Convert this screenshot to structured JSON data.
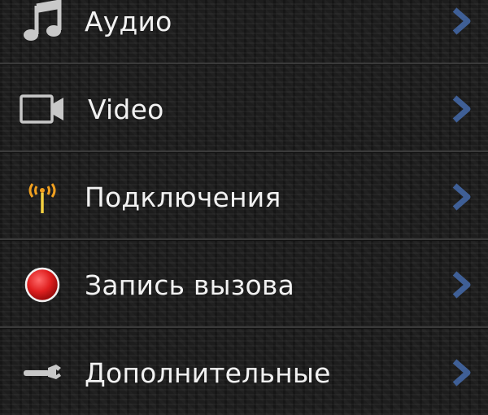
{
  "menu": {
    "items": [
      {
        "label": "Аудио",
        "icon": "music-note-icon"
      },
      {
        "label": "Video",
        "icon": "video-camera-icon"
      },
      {
        "label": "Подключения",
        "icon": "antenna-signal-icon"
      },
      {
        "label": "Запись вызова",
        "icon": "record-icon"
      },
      {
        "label": "Дополнительные",
        "icon": "wrench-icon"
      }
    ]
  },
  "colors": {
    "chevron": "#3f5f96",
    "text": "#f2f2f2",
    "record": "#e01f1f",
    "antenna": "#f0a020"
  }
}
